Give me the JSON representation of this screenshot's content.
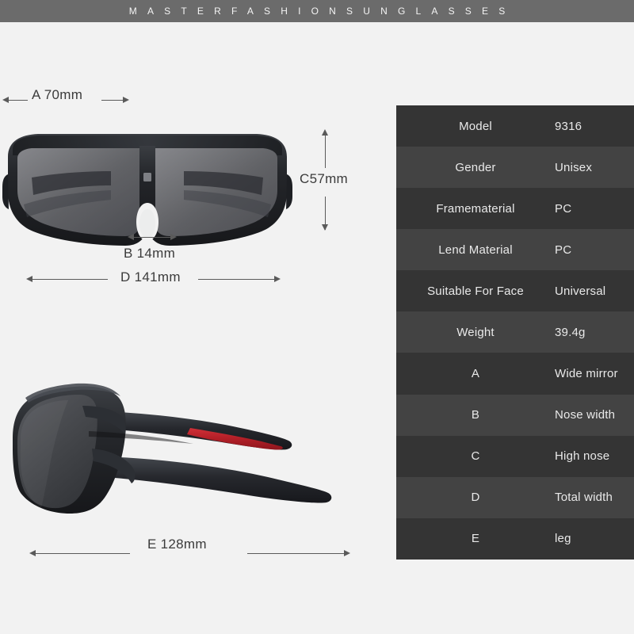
{
  "brand": {
    "banner_text": "MASTERFASHIONSUNGLASSES"
  },
  "colors": {
    "background": "#f2f2f2",
    "banner": "#6b6b6b",
    "row_dark": "#343434",
    "row_light": "#434343",
    "text_light": "#e9e9e9",
    "frame_black": "#24262a",
    "lens_gray": "#5d5e62",
    "accent_red": "#b52028",
    "dimension_line": "#5a5a5a"
  },
  "dimensions": {
    "a": "A 70mm",
    "b": "B 14mm",
    "c": "C57mm",
    "d": "D 141mm",
    "e": "E 128mm"
  },
  "spec_table": {
    "rows": [
      {
        "label": "Model",
        "value": "9316"
      },
      {
        "label": "Gender",
        "value": "Unisex"
      },
      {
        "label": "Framematerial",
        "value": "PC"
      },
      {
        "label": "Lend Material",
        "value": "PC"
      },
      {
        "label": "Suitable For Face",
        "value": "Universal"
      },
      {
        "label": "Weight",
        "value": "39.4g"
      },
      {
        "label": "A",
        "value": "Wide mirror"
      },
      {
        "label": "B",
        "value": "Nose width"
      },
      {
        "label": "C",
        "value": "High nose"
      },
      {
        "label": "D",
        "value": "Total width"
      },
      {
        "label": "E",
        "value": "leg"
      }
    ]
  },
  "images": {
    "front_view_alt": "sunglasses-front-view",
    "side_view_alt": "sunglasses-side-view"
  }
}
